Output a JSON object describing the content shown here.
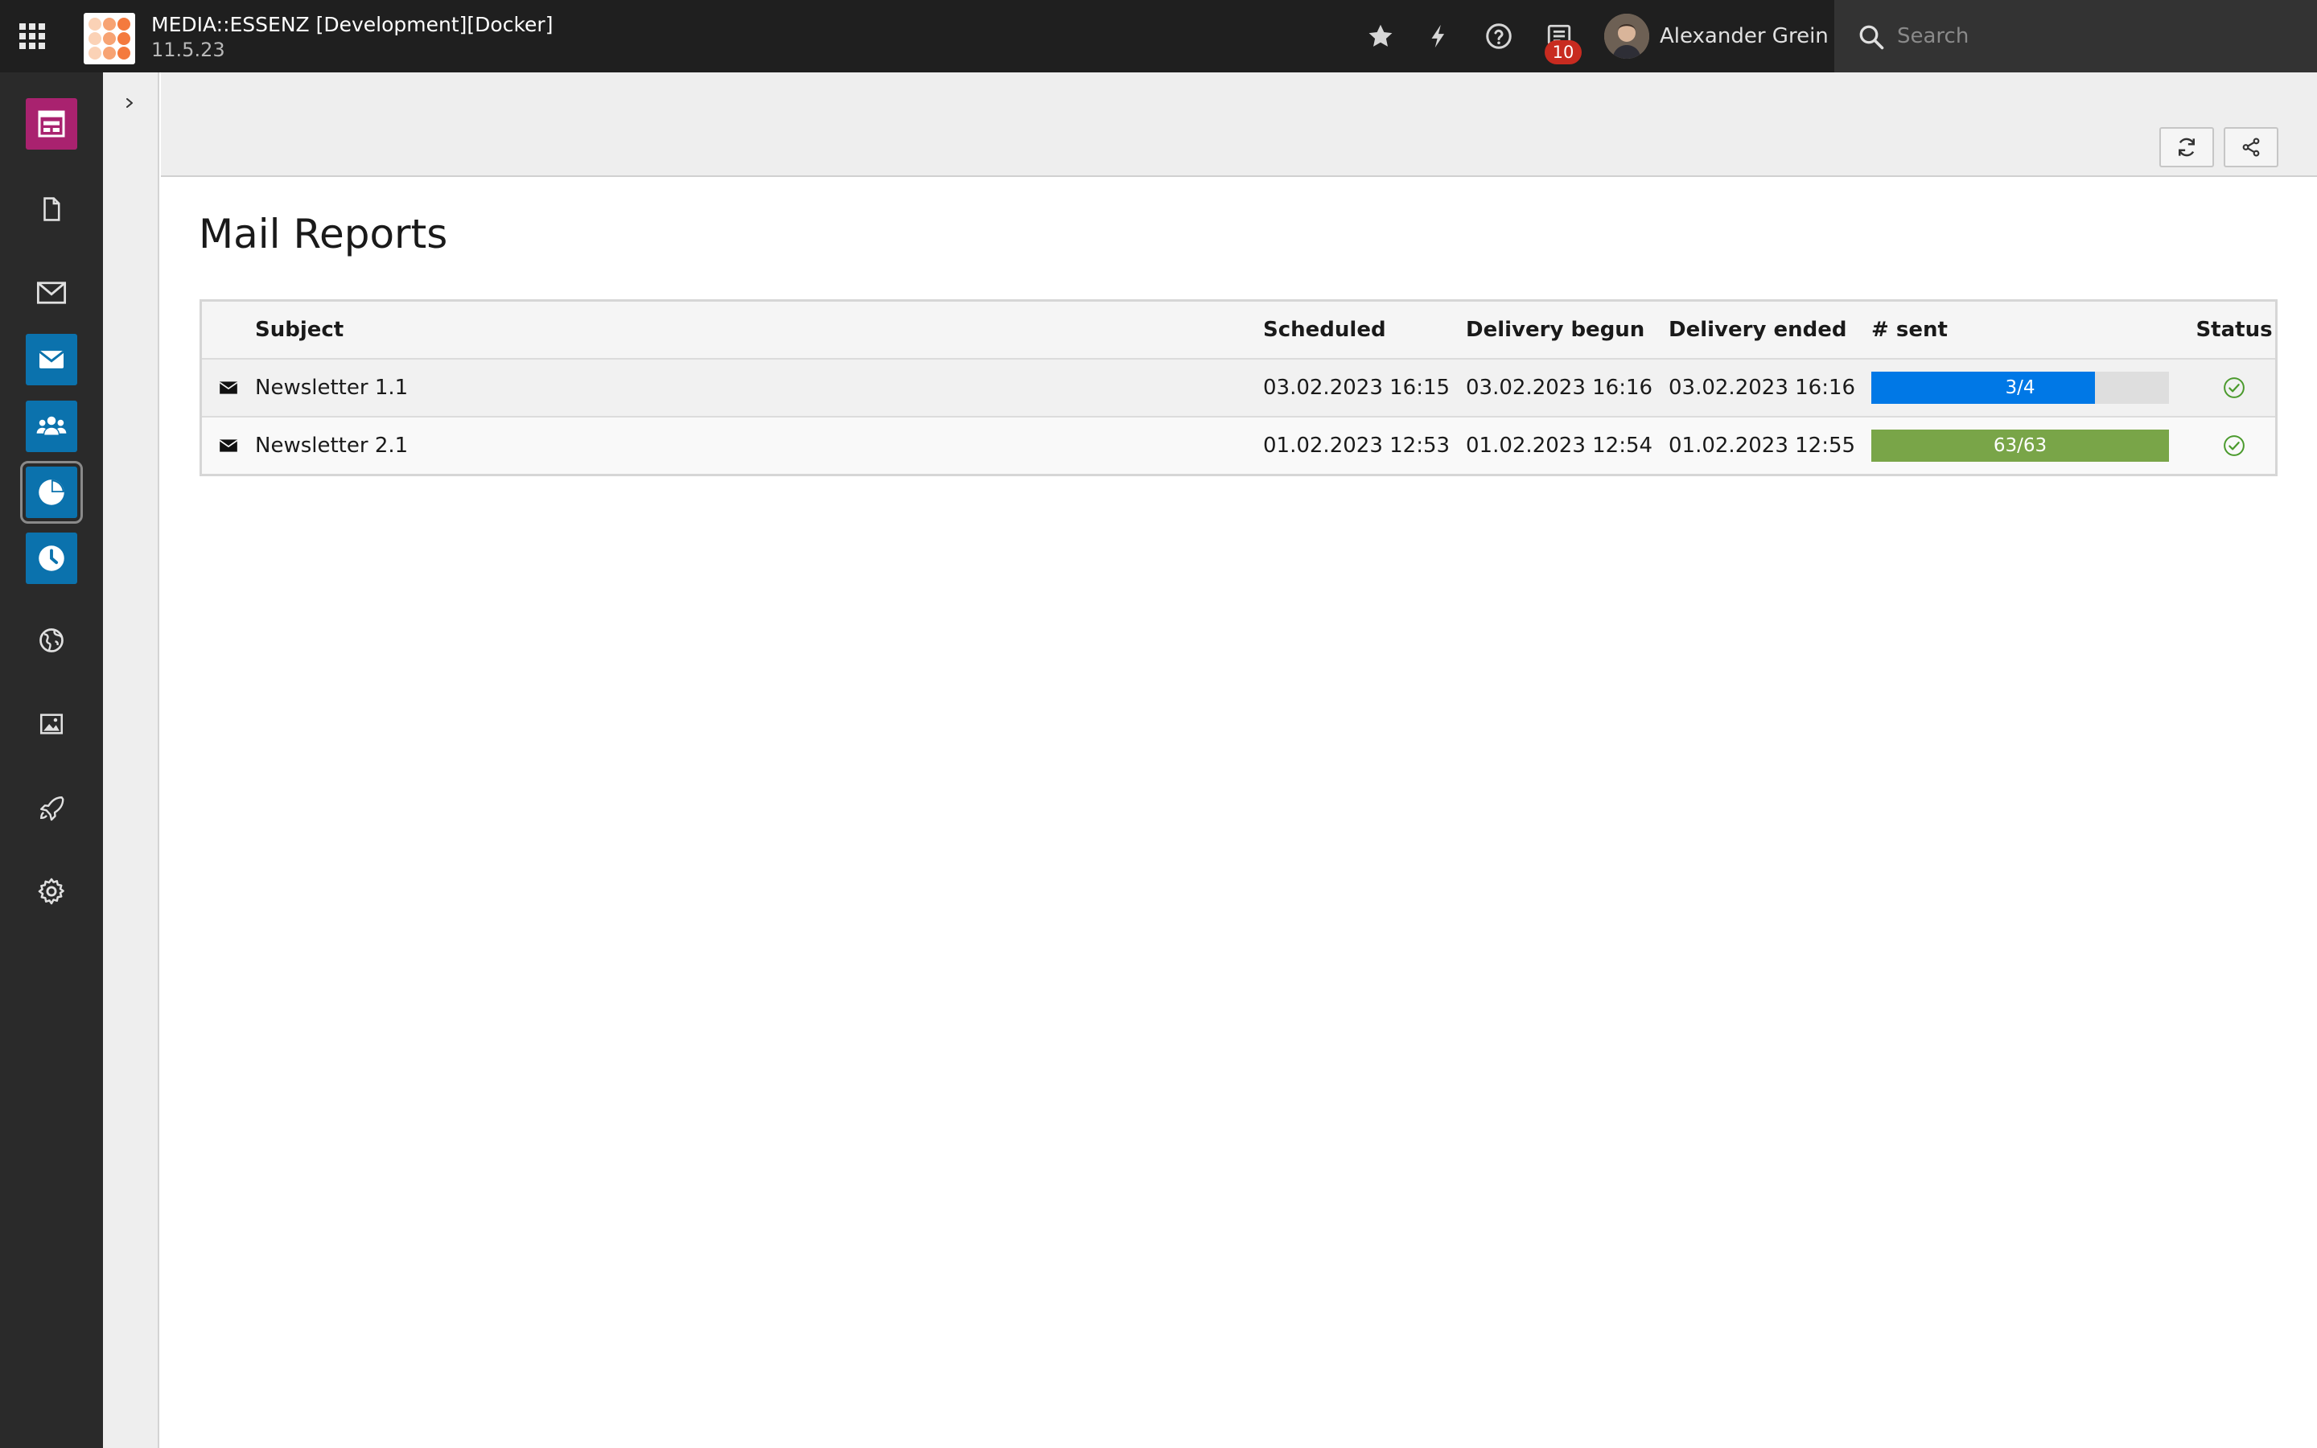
{
  "topbar": {
    "site_name": "MEDIA::ESSENZ [Development][Docker]",
    "version": "11.5.23",
    "user_name": "Alexander Grein",
    "notification_count": "10",
    "search_placeholder": "Search",
    "icons": [
      "apps-grid-icon",
      "star-icon",
      "bolt-icon",
      "help-icon",
      "system-information-icon"
    ]
  },
  "sidebar": {
    "modules": [
      {
        "name": "web-layout",
        "bg": "#a9226f"
      },
      {
        "name": "page",
        "bg": "transparent"
      },
      {
        "name": "mail",
        "bg": "transparent"
      },
      {
        "name": "mail-wizard",
        "bg": "#0b72ad"
      },
      {
        "name": "recipient-lists",
        "bg": "#0b72ad"
      },
      {
        "name": "mail-reports",
        "bg": "#0b72ad",
        "active": true
      },
      {
        "name": "mail-queue",
        "bg": "#0b72ad"
      },
      {
        "name": "sites",
        "bg": "transparent"
      },
      {
        "name": "filelist",
        "bg": "transparent"
      },
      {
        "name": "extensions",
        "bg": "transparent"
      },
      {
        "name": "settings",
        "bg": "transparent"
      }
    ]
  },
  "main": {
    "title": "Mail Reports",
    "columns": [
      "Subject",
      "Scheduled",
      "Delivery begun",
      "Delivery ended",
      "# sent",
      "Status"
    ],
    "rows": [
      {
        "subject": "Newsletter 1.1",
        "scheduled": "03.02.2023 16:15",
        "begun": "03.02.2023 16:16",
        "ended": "03.02.2023 16:16",
        "sent_label": "3/4",
        "sent_fraction": 0.75,
        "bar_color": "#0078e6",
        "status": "check-circle-icon"
      },
      {
        "subject": "Newsletter 2.1",
        "scheduled": "01.02.2023 12:53",
        "begun": "01.02.2023 12:54",
        "ended": "01.02.2023 12:55",
        "sent_label": "63/63",
        "sent_fraction": 1.0,
        "bar_color": "#79a548",
        "status": "check-circle-icon"
      }
    ]
  }
}
